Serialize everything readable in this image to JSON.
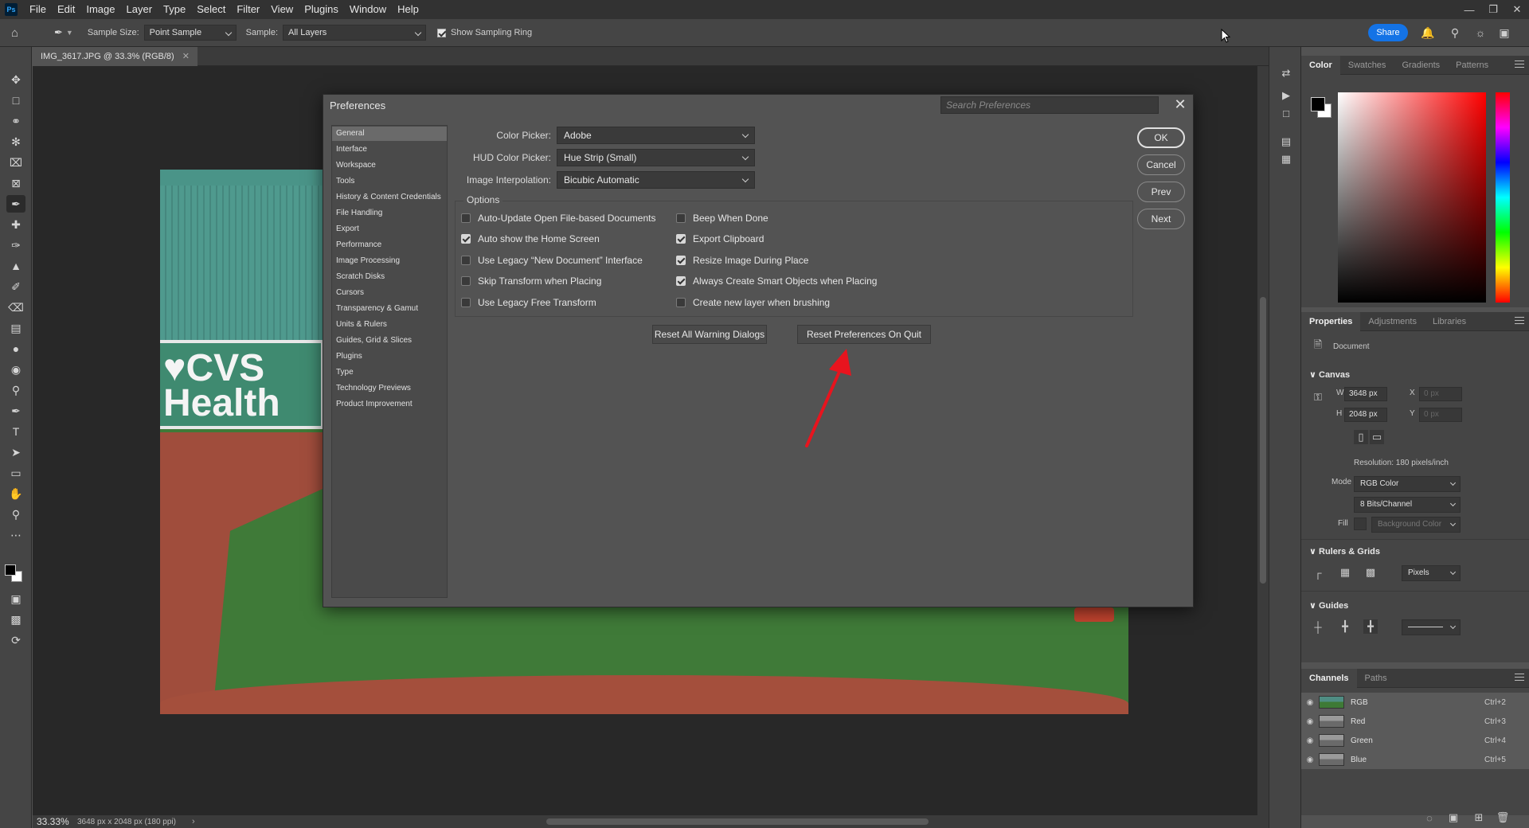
{
  "app": {
    "logo": "Ps",
    "menu": [
      "File",
      "Edit",
      "Image",
      "Layer",
      "Type",
      "Select",
      "Filter",
      "View",
      "Plugins",
      "Window",
      "Help"
    ],
    "window_controls": [
      "minimize",
      "restore",
      "close"
    ]
  },
  "options_bar": {
    "sample_size_label": "Sample Size:",
    "sample_size_value": "Point Sample",
    "sample_label": "Sample:",
    "sample_value": "All Layers",
    "show_sampling_ring_label": "Show Sampling Ring",
    "show_sampling_ring_checked": true,
    "share_label": "Share"
  },
  "document": {
    "tab_title": "IMG_3617.JPG @ 33.3% (RGB/8)",
    "sign_text": "CVS\nHealth"
  },
  "status_bar": {
    "zoom": "33.33%",
    "info": "3648 px x 2048 px (180 ppi)"
  },
  "color_panel": {
    "tabs": [
      "Color",
      "Swatches",
      "Gradients",
      "Patterns"
    ],
    "active_tab": "Color",
    "foreground": "#000000",
    "background": "#ffffff",
    "hue": "#ff0000"
  },
  "properties_panel": {
    "tabs": [
      "Properties",
      "Adjustments",
      "Libraries"
    ],
    "active_tab": "Properties",
    "doc_label": "Document",
    "canvas_title": "Canvas",
    "w_label": "W",
    "w_value": "3648 px",
    "h_label": "H",
    "h_value": "2048 px",
    "x_label": "X",
    "x_value": "0 px",
    "y_label": "Y",
    "y_value": "0 px",
    "resolution": "Resolution: 180 pixels/inch",
    "mode_label": "Mode",
    "mode_value": "RGB Color",
    "bits_value": "8 Bits/Channel",
    "fill_label": "Fill",
    "fill_value": "Background Color",
    "rulers_title": "Rulers & Grids",
    "units_value": "Pixels",
    "guides_title": "Guides"
  },
  "channels_panel": {
    "tabs": [
      "Channels",
      "Paths"
    ],
    "active_tab": "Channels",
    "channels": [
      {
        "name": "RGB",
        "shortcut": "Ctrl+2"
      },
      {
        "name": "Red",
        "shortcut": "Ctrl+3"
      },
      {
        "name": "Green",
        "shortcut": "Ctrl+4"
      },
      {
        "name": "Blue",
        "shortcut": "Ctrl+5"
      }
    ]
  },
  "preferences": {
    "title": "Preferences",
    "search_placeholder": "Search Preferences",
    "sections": [
      "General",
      "Interface",
      "Workspace",
      "Tools",
      "History & Content Credentials",
      "File Handling",
      "Export",
      "Performance",
      "Image Processing",
      "Scratch Disks",
      "Cursors",
      "Transparency & Gamut",
      "Units & Rulers",
      "Guides, Grid & Slices",
      "Plugins",
      "Type",
      "Technology Previews",
      "Product Improvement"
    ],
    "active_section": "General",
    "color_picker_label": "Color Picker:",
    "color_picker_value": "Adobe",
    "hud_color_picker_label": "HUD Color Picker:",
    "hud_color_picker_value": "Hue Strip (Small)",
    "image_interpolation_label": "Image Interpolation:",
    "image_interpolation_value": "Bicubic Automatic",
    "options_title": "Options",
    "options": [
      {
        "label": "Auto-Update Open File-based Documents",
        "checked": false
      },
      {
        "label": "Beep When Done",
        "checked": false
      },
      {
        "label": "Auto show the Home Screen",
        "checked": true
      },
      {
        "label": "Export Clipboard",
        "checked": true
      },
      {
        "label": "Use Legacy “New Document” Interface",
        "checked": false
      },
      {
        "label": "Resize Image During Place",
        "checked": true
      },
      {
        "label": "Skip Transform when Placing",
        "checked": false
      },
      {
        "label": "Always Create Smart Objects when Placing",
        "checked": true
      },
      {
        "label": "Use Legacy Free Transform",
        "checked": false
      },
      {
        "label": "Create new layer when brushing",
        "checked": false
      }
    ],
    "reset_warnings_label": "Reset All Warning Dialogs",
    "reset_prefs_label": "Reset Preferences On Quit",
    "ok_label": "OK",
    "cancel_label": "Cancel",
    "prev_label": "Prev",
    "next_label": "Next"
  },
  "annotation": {
    "arrow_color": "#e8141e"
  }
}
